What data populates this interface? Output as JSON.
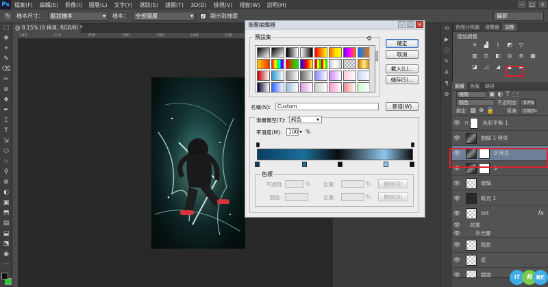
{
  "app": {
    "logo": "Ps"
  },
  "menu": [
    "檔案(F)",
    "編輯(E)",
    "影像(I)",
    "圖層(L)",
    "文字(Y)",
    "選取(S)",
    "濾鏡(T)",
    "3D(D)",
    "檢視(V)",
    "視窗(W)",
    "說明(H)"
  ],
  "options_bar": {
    "sample_size_label": "樣本尺寸：",
    "sample_size_value": "點狀樣本",
    "sample_label": "樣本：",
    "sample_value": "全部圖層",
    "show_ring_label": "顯示取樣環",
    "workspace": "攝影"
  },
  "document": {
    "tab": "@ 8.15% (9 拷貝, RGB/8) *",
    "ruler_ticks": [
      "240",
      "220",
      "200",
      "180",
      "160",
      "140",
      "120",
      "100",
      "80"
    ]
  },
  "tools": [
    "⬚",
    "✥",
    "⌖",
    "✎",
    "⌫",
    "✂",
    "⊘",
    "❖",
    "✒",
    "⌶",
    "T",
    "⇲",
    "⬭",
    "☞",
    "⚲",
    "⊕",
    "◐",
    "▣",
    "⬒",
    "▤",
    "⬓",
    "⬔",
    "◉",
    "⋯"
  ],
  "dialog": {
    "title": "漸層編輯器",
    "presets_legend": "預設集",
    "ok": "確定",
    "cancel": "取消",
    "load": "載入(L)...",
    "save": "儲存(S)...",
    "name_label": "名稱(N):",
    "name_value": "Custom",
    "new_button": "新增(W)",
    "type_label": "漸層類型(T):",
    "type_value": "純色",
    "smoothness_label": "平滑度(M):",
    "smoothness_value": "100",
    "smoothness_unit": "%",
    "stops_legend": "色標",
    "opacity_label": "不透明:",
    "opacity_unit": "%",
    "location_label": "位置:",
    "location_unit": "%",
    "delete_label": "刪除(D)",
    "color_label": "顏色:",
    "location2_label": "位置:",
    "location2_unit": "%",
    "delete2_label": "刪除(D)",
    "gradient_stops": [
      {
        "position": 0,
        "color": "#0a3d62"
      },
      {
        "position": 30,
        "color": "#1b6f9a"
      },
      {
        "position": 52,
        "color": "#0b0b0b"
      },
      {
        "position": 82,
        "color": "#8fc6ec"
      },
      {
        "position": 100,
        "color": "#0b0b0b"
      }
    ]
  },
  "right_panel": {
    "top_tabs": [
      "色階分佈圖",
      "導覽器",
      "調整"
    ],
    "adjustments_title": "增加調整",
    "layer_tabs": [
      "圖層",
      "色版",
      "路徑"
    ],
    "filter_label": "種類",
    "blend_mode": "顏色",
    "opacity_label": "不透明度:",
    "opacity_value": "57%",
    "lock_label": "鎖定:",
    "fill_label": "填滿:",
    "fill_value": "100%",
    "layers": [
      {
        "name": "色彩平衡 1",
        "thumb": "white"
      },
      {
        "name": "曲線 1 拷貝",
        "thumb": "white"
      },
      {
        "name": "9 拷貝",
        "thumb": "white",
        "selected": true
      },
      {
        "name": "9",
        "thumb": "white"
      },
      {
        "name": "玻璃",
        "thumb": "check"
      },
      {
        "name": "眩光 1",
        "thumb": "dark"
      },
      {
        "name": "bl4",
        "thumb": "check",
        "fx": "fx"
      },
      {
        "name": "效果",
        "thumb": "none"
      },
      {
        "name": "外光暈",
        "thumb": "none"
      },
      {
        "name": "陰影",
        "thumb": "check"
      },
      {
        "name": "底",
        "thumb": "check"
      },
      {
        "name": "鏡頭",
        "thumb": "check"
      }
    ]
  },
  "watermark": [
    "iT",
    "邦",
    "幫忙"
  ]
}
